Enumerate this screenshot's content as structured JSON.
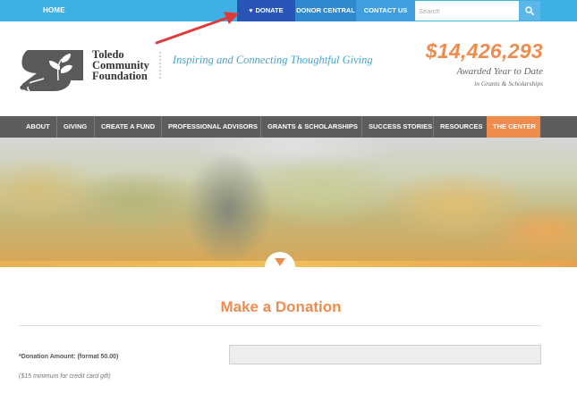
{
  "topbar": {
    "home_label": "HOME",
    "donate_label": "DONATE",
    "donor_central_label": "DONOR CENTRAL",
    "contact_label": "CONTACT US",
    "search_placeholder": "Search"
  },
  "header": {
    "logo_lines": [
      "Toledo",
      "Community",
      "Foundation"
    ],
    "tagline": "Inspiring and Connecting Thoughtful Giving",
    "amount": "$14,426,293",
    "amount_caption": "Awarded Year to Date",
    "amount_subcaption": "in Grants & Scholarships"
  },
  "nav": {
    "items": [
      {
        "label": "ABOUT"
      },
      {
        "label": "GIVING"
      },
      {
        "label": "CREATE A FUND"
      },
      {
        "label": "PROFESSIONAL ADVISORS"
      },
      {
        "label": "GRANTS & SCHOLARSHIPS"
      },
      {
        "label": "SUCCESS STORIES"
      },
      {
        "label": "RESOURCES"
      },
      {
        "label": "THE CENTER"
      }
    ]
  },
  "page": {
    "title": "Make a Donation",
    "donation_label": "*Donation Amount: (format 50.00)",
    "donation_note": "($15 minimum for credit card gift)",
    "donation_value": ""
  },
  "colors": {
    "topbar": "#3fb0e4",
    "donate": "#2a55b8",
    "accent": "#ef8c4d",
    "nav": "#5d5d5d",
    "tagline": "#3fa5d8",
    "annotation_arrow": "#e0393a"
  },
  "icons": {
    "search": "search-icon",
    "donate": "heart-icon",
    "hero": "chevron-down-icon",
    "logo": "hand-leaf-logo-icon",
    "annotation": "red-arrow-icon"
  }
}
